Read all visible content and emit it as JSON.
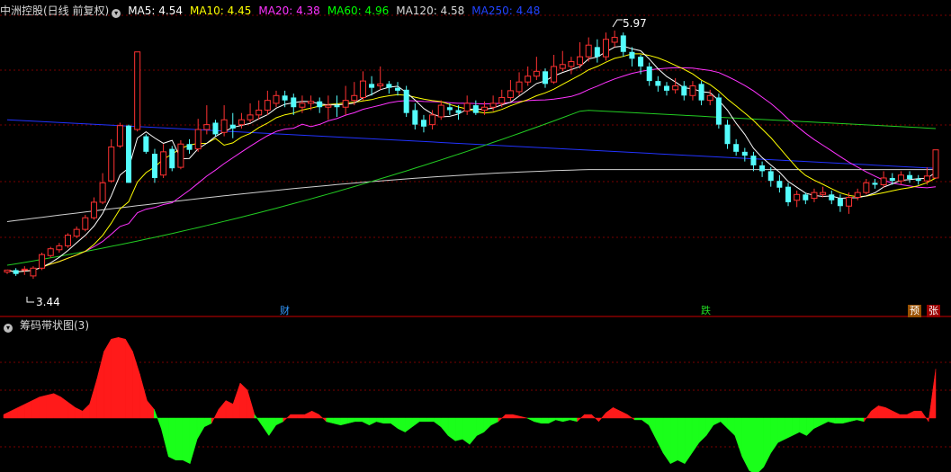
{
  "header": {
    "stock_title": "中洲控股(日线 前复权)",
    "ma_items": [
      {
        "text": "MA5: 4.54",
        "color": "#ffffff"
      },
      {
        "text": "MA10: 4.45",
        "color": "#ffff00"
      },
      {
        "text": "MA20: 4.38",
        "color": "#ff33ff"
      },
      {
        "text": "MA60: 4.96",
        "color": "#00ff00"
      },
      {
        "text": "MA120: 4.58",
        "color": "#d8d8d8"
      },
      {
        "text": "MA250: 4.48",
        "color": "#2244ff"
      }
    ]
  },
  "annotations": {
    "high_label": "5.97",
    "low_label": "3.44"
  },
  "event_tags": [
    {
      "text": "财",
      "color": "#1e90ff",
      "bg": "#001133"
    },
    {
      "text": "跌",
      "color": "#00cc00",
      "bg": "#002200"
    },
    {
      "text": "预",
      "color": "#ffffff",
      "bg": "#aa5500"
    },
    {
      "text": "张",
      "color": "#ffffff",
      "bg": "#aa0000"
    }
  ],
  "lower_panel": {
    "title": "筹码带状图(3)"
  },
  "colors": {
    "up": "#ff3232",
    "down": "#54fcfc",
    "grid": "#7a0000",
    "divider": "#cc0000"
  },
  "chart_data": {
    "type": "candlestick",
    "price_range": [
      3.3,
      6.1
    ],
    "candles": [
      [
        3.48,
        3.5,
        3.46,
        3.49
      ],
      [
        3.5,
        3.46,
        3.52,
        3.44
      ],
      [
        3.5,
        3.51,
        3.45,
        3.54
      ],
      [
        3.44,
        3.52,
        3.41,
        3.54
      ],
      [
        3.52,
        3.66,
        3.5,
        3.68
      ],
      [
        3.65,
        3.72,
        3.63,
        3.74
      ],
      [
        3.71,
        3.75,
        3.68,
        3.78
      ],
      [
        3.75,
        3.86,
        3.73,
        3.88
      ],
      [
        3.85,
        3.92,
        3.83,
        3.95
      ],
      [
        3.92,
        4.04,
        3.9,
        4.07
      ],
      [
        4.04,
        4.2,
        4.02,
        4.25
      ],
      [
        4.2,
        4.4,
        4.18,
        4.5
      ],
      [
        4.42,
        4.77,
        4.4,
        4.85
      ],
      [
        4.78,
        4.99,
        4.76,
        5.02
      ],
      [
        4.99,
        4.4,
        4.9,
        5.0
      ],
      [
        4.95,
        5.75,
        4.93,
        5.75
      ],
      [
        4.88,
        4.72,
        4.9,
        4.7
      ],
      [
        4.7,
        4.45,
        4.75,
        4.4
      ],
      [
        4.48,
        4.72,
        4.45,
        4.8
      ],
      [
        4.75,
        4.55,
        4.78,
        4.52
      ],
      [
        4.56,
        4.8,
        4.54,
        4.84
      ],
      [
        4.8,
        4.74,
        4.85,
        4.7
      ],
      [
        4.75,
        4.95,
        4.72,
        5.06
      ],
      [
        4.95,
        5.0,
        4.9,
        5.2
      ],
      [
        5.02,
        4.9,
        5.05,
        4.88
      ],
      [
        4.92,
        5.05,
        4.88,
        5.2
      ],
      [
        5.0,
        4.96,
        5.12,
        4.86
      ],
      [
        5.0,
        5.05,
        4.96,
        5.12
      ],
      [
        5.05,
        5.1,
        5.02,
        5.22
      ],
      [
        5.1,
        5.15,
        5.05,
        5.25
      ],
      [
        5.15,
        5.25,
        5.1,
        5.35
      ],
      [
        5.22,
        5.3,
        5.18,
        5.35
      ],
      [
        5.3,
        5.25,
        5.35,
        5.18
      ],
      [
        5.28,
        5.18,
        5.32,
        5.1
      ],
      [
        5.18,
        5.22,
        5.12,
        5.3
      ],
      [
        5.22,
        5.24,
        5.15,
        5.3
      ],
      [
        5.24,
        5.18,
        5.28,
        5.12
      ],
      [
        5.18,
        5.2,
        5.05,
        5.3
      ],
      [
        5.2,
        5.18,
        5.3,
        5.08
      ],
      [
        5.18,
        5.25,
        5.1,
        5.4
      ],
      [
        5.25,
        5.3,
        5.2,
        5.44
      ],
      [
        5.28,
        5.45,
        5.25,
        5.55
      ],
      [
        5.42,
        5.38,
        5.5,
        5.3
      ],
      [
        5.4,
        5.42,
        5.36,
        5.6
      ],
      [
        5.42,
        5.38,
        5.45,
        5.32
      ],
      [
        5.38,
        5.35,
        5.44,
        5.3
      ],
      [
        5.36,
        5.12,
        5.4,
        5.08
      ],
      [
        5.15,
        5.0,
        5.22,
        4.95
      ],
      [
        5.05,
        4.98,
        5.1,
        4.92
      ],
      [
        5.0,
        5.1,
        4.95,
        5.15
      ],
      [
        5.08,
        5.2,
        5.05,
        5.25
      ],
      [
        5.18,
        5.15,
        5.22,
        5.1
      ],
      [
        5.15,
        5.12,
        5.2,
        5.05
      ],
      [
        5.14,
        5.22,
        5.1,
        5.3
      ],
      [
        5.2,
        5.12,
        5.25,
        5.1
      ],
      [
        5.15,
        5.18,
        5.1,
        5.24
      ],
      [
        5.18,
        5.22,
        5.14,
        5.3
      ],
      [
        5.22,
        5.28,
        5.18,
        5.36
      ],
      [
        5.28,
        5.35,
        5.24,
        5.46
      ],
      [
        5.34,
        5.44,
        5.3,
        5.54
      ],
      [
        5.44,
        5.5,
        5.4,
        5.6
      ],
      [
        5.5,
        5.55,
        5.46,
        5.7
      ],
      [
        5.55,
        5.42,
        5.58,
        5.38
      ],
      [
        5.44,
        5.6,
        5.42,
        5.72
      ],
      [
        5.58,
        5.62,
        5.55,
        5.76
      ],
      [
        5.6,
        5.65,
        5.52,
        5.7
      ],
      [
        5.62,
        5.7,
        5.58,
        5.85
      ],
      [
        5.7,
        5.82,
        5.65,
        5.9
      ],
      [
        5.8,
        5.7,
        5.88,
        5.64
      ],
      [
        5.7,
        5.88,
        5.66,
        5.95
      ],
      [
        5.85,
        5.9,
        5.8,
        5.97
      ],
      [
        5.92,
        5.75,
        5.95,
        5.7
      ],
      [
        5.75,
        5.68,
        5.8,
        5.6
      ],
      [
        5.7,
        5.6,
        5.72,
        5.52
      ],
      [
        5.6,
        5.45,
        5.64,
        5.4
      ],
      [
        5.45,
        5.4,
        5.5,
        5.34
      ],
      [
        5.4,
        5.35,
        5.44,
        5.3
      ],
      [
        5.36,
        5.4,
        5.32,
        5.48
      ],
      [
        5.4,
        5.3,
        5.45,
        5.25
      ],
      [
        5.3,
        5.4,
        5.25,
        5.45
      ],
      [
        5.42,
        5.25,
        5.45,
        5.2
      ],
      [
        5.25,
        5.3,
        5.2,
        5.36
      ],
      [
        5.28,
        5.0,
        5.32,
        4.96
      ],
      [
        5.0,
        4.8,
        5.05,
        4.75
      ],
      [
        4.8,
        4.72,
        4.85,
        4.68
      ],
      [
        4.72,
        4.68,
        4.76,
        4.62
      ],
      [
        4.68,
        4.58,
        4.72,
        4.52
      ],
      [
        4.58,
        4.52,
        4.62,
        4.46
      ],
      [
        4.52,
        4.42,
        4.56,
        4.36
      ],
      [
        4.42,
        4.35,
        4.48,
        4.3
      ],
      [
        4.36,
        4.2,
        4.4,
        4.16
      ],
      [
        4.22,
        4.28,
        4.15,
        4.32
      ],
      [
        4.28,
        4.22,
        4.3,
        4.18
      ],
      [
        4.24,
        4.3,
        4.2,
        4.34
      ],
      [
        4.28,
        4.3,
        4.25,
        4.36
      ],
      [
        4.28,
        4.22,
        4.32,
        4.18
      ],
      [
        4.24,
        4.16,
        4.28,
        4.1
      ],
      [
        4.16,
        4.25,
        4.08,
        4.3
      ],
      [
        4.25,
        4.3,
        4.22,
        4.34
      ],
      [
        4.3,
        4.4,
        4.28,
        4.44
      ],
      [
        4.4,
        4.38,
        4.44,
        4.34
      ],
      [
        4.38,
        4.45,
        4.35,
        4.52
      ],
      [
        4.45,
        4.42,
        4.5,
        4.38
      ],
      [
        4.42,
        4.48,
        4.38,
        4.52
      ],
      [
        4.48,
        4.44,
        4.52,
        4.4
      ],
      [
        4.44,
        4.42,
        4.48,
        4.38
      ],
      [
        4.42,
        4.47,
        4.38,
        4.56
      ],
      [
        4.45,
        4.74,
        4.44,
        4.74
      ]
    ],
    "chip_band": [
      2,
      4,
      6,
      8,
      10,
      12,
      13,
      14,
      12,
      9,
      6,
      4,
      8,
      22,
      38,
      45,
      46,
      45,
      38,
      25,
      10,
      5,
      -6,
      -22,
      -24,
      -24,
      -26,
      -12,
      -5,
      -3,
      5,
      10,
      8,
      20,
      16,
      2,
      -4,
      -10,
      -4,
      -2,
      2,
      2,
      2,
      4,
      2,
      -2,
      -3,
      -4,
      -3,
      -2,
      -2,
      -4,
      -2,
      -3,
      -3,
      -6,
      -8,
      -5,
      -2,
      -2,
      -2,
      -5,
      -10,
      -13,
      -12,
      -15,
      -10,
      -8,
      -4,
      -2,
      2,
      2,
      1,
      0,
      -2,
      -3,
      -3,
      -1,
      -2,
      -1,
      -2,
      2,
      2,
      -2,
      3,
      6,
      4,
      2,
      -1,
      -1,
      -4,
      -12,
      -20,
      -26,
      -24,
      -26,
      -20,
      -14,
      -10,
      -4,
      -2,
      -6,
      -10,
      -22,
      -30,
      -32,
      -28,
      -20,
      -14,
      -12,
      -10,
      -8,
      -10,
      -6,
      -4,
      -2,
      -3,
      -3,
      -2,
      -1,
      -2,
      4,
      7,
      6,
      4,
      2,
      2,
      4,
      4,
      -2,
      28
    ]
  }
}
